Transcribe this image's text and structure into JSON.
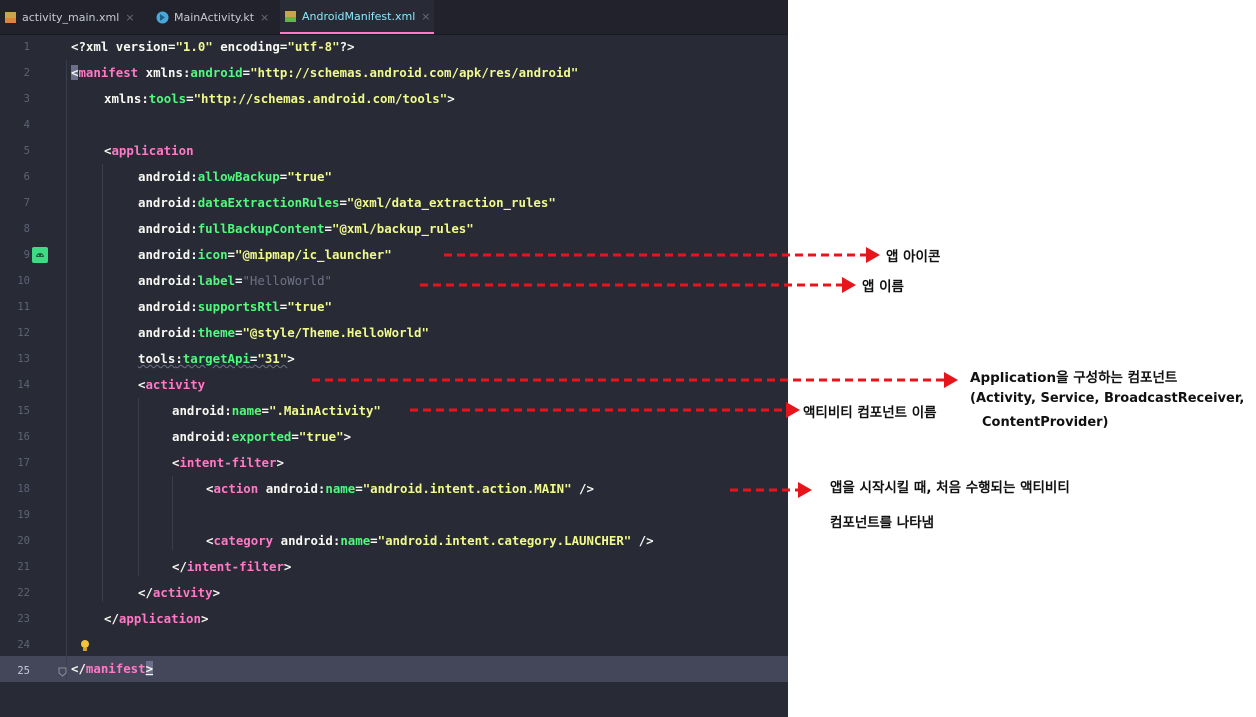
{
  "tabs": [
    {
      "label": "activity_main.xml",
      "icon": "xml-file-icon"
    },
    {
      "label": "MainActivity.kt",
      "icon": "kotlin-file-icon"
    },
    {
      "label": "AndroidManifest.xml",
      "icon": "manifest-file-icon",
      "active": true
    }
  ],
  "tab_close": "×",
  "line_numbers": [
    "1",
    "2",
    "3",
    "4",
    "5",
    "6",
    "7",
    "8",
    "9",
    "10",
    "11",
    "12",
    "13",
    "14",
    "15",
    "16",
    "17",
    "18",
    "19",
    "20",
    "21",
    "22",
    "23",
    "24",
    "25"
  ],
  "code": {
    "l1": {
      "open": "<?xml version=",
      "v1": "\"1.0\"",
      "mid": " encoding=",
      "v2": "\"utf-8\"",
      "close": "?>"
    },
    "l2": {
      "tag": "manifest",
      "ns": "xmlns",
      "colon": ":",
      "attr": "android",
      "eq": "=",
      "val": "\"http://schemas.android.com/apk/res/android\""
    },
    "l3": {
      "ns": "xmlns",
      "colon": ":",
      "attr": "tools",
      "eq": "=",
      "val": "\"http://schemas.android.com/tools\"",
      "close": ">"
    },
    "l5": {
      "open": "<",
      "tag": "application"
    },
    "l6": {
      "ns": "android",
      "attr": "allowBackup",
      "val": "\"true\""
    },
    "l7": {
      "ns": "android",
      "attr": "dataExtractionRules",
      "val": "\"@xml/data_extraction_rules\""
    },
    "l8": {
      "ns": "android",
      "attr": "fullBackupContent",
      "val": "\"@xml/backup_rules\""
    },
    "l9": {
      "ns": "android",
      "attr": "icon",
      "val": "\"@mipmap/ic_launcher\""
    },
    "l10": {
      "ns": "android",
      "attr": "label",
      "val": "\"HelloWorld\""
    },
    "l11": {
      "ns": "android",
      "attr": "supportsRtl",
      "val": "\"true\""
    },
    "l12": {
      "ns": "android",
      "attr": "theme",
      "val": "\"@style/Theme.HelloWorld\""
    },
    "l13": {
      "ns": "tools",
      "attr": "targetApi",
      "val": "\"31\"",
      "close": ">"
    },
    "l14": {
      "open": "<",
      "tag": "activity"
    },
    "l15": {
      "ns": "android",
      "attr": "name",
      "val": "\".MainActivity\""
    },
    "l16": {
      "ns": "android",
      "attr": "exported",
      "val": "\"true\"",
      "close": ">"
    },
    "l17": {
      "open": "<",
      "tag": "intent-filter",
      "close": ">"
    },
    "l18": {
      "open": "<",
      "tag": "action",
      "ns": " android",
      "attr": "name",
      "val": "\"android.intent.action.MAIN\"",
      "close": " />"
    },
    "l20": {
      "open": "<",
      "tag": "category",
      "ns": " android",
      "attr": "name",
      "val": "\"android.intent.category.LAUNCHER\"",
      "close": " />"
    },
    "l21": {
      "open": "</",
      "tag": "intent-filter",
      "close": ">"
    },
    "l22": {
      "open": "</",
      "tag": "activity",
      "close": ">"
    },
    "l23": {
      "open": "</",
      "tag": "application",
      "close": ">"
    },
    "l25": {
      "open": "</",
      "tag": "manifest",
      "close": ">"
    }
  },
  "annotations": {
    "app_icon": "앱 아이콘",
    "app_name": "앱 이름",
    "components_title": "Application을 구성하는 컴포넌트",
    "components_list_1": "(Activity, Service, BroadcastReceiver,",
    "components_list_2": "ContentProvider)",
    "activity_name": "액티비티 컴포넌트 이름",
    "launcher_1": "앱을 시작시킬 때, 처음 수행되는 액티비티",
    "launcher_2": "컴포넌트를 나타냄"
  },
  "colors": {
    "editor_bg": "#282a36",
    "tag": "#ff79c6",
    "attribute": "#50fa7b",
    "string": "#f1fa8c",
    "arrow": "#e8141c"
  }
}
